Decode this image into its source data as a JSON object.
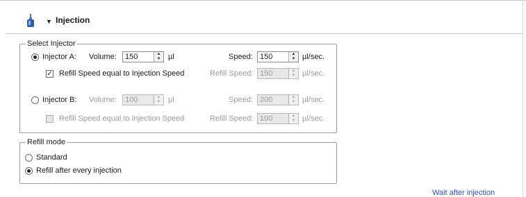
{
  "section": {
    "title": "Injection"
  },
  "select_injector": {
    "legend": "Select Injector",
    "injector_a": {
      "label": "Injector A:",
      "volume_label": "Volume:",
      "volume_value": "150",
      "volume_unit": "µl",
      "speed_label": "Speed:",
      "speed_value": "150",
      "speed_unit": "µl/sec.",
      "refill_check_label": "Refill Speed equal to Injection Speed",
      "refill_speed_label": "Refill Speed:",
      "refill_speed_value": "150",
      "refill_speed_unit": "µl/sec."
    },
    "injector_b": {
      "label": "Injector B:",
      "volume_label": "Volume:",
      "volume_value": "100",
      "volume_unit": "µl",
      "speed_label": "Speed:",
      "speed_value": "200",
      "speed_unit": "µl/sec.",
      "refill_check_label": "Refill Speed equal to Injection Speed",
      "refill_speed_label": "Refill Speed:",
      "refill_speed_value": "100",
      "refill_speed_unit": "µl/sec."
    }
  },
  "refill_mode": {
    "legend": "Refill mode",
    "options": [
      "Standard",
      "Refill after every injection"
    ],
    "selected": "Refill after every injection"
  },
  "link": {
    "wait_after_injection": "Wait after injection"
  }
}
